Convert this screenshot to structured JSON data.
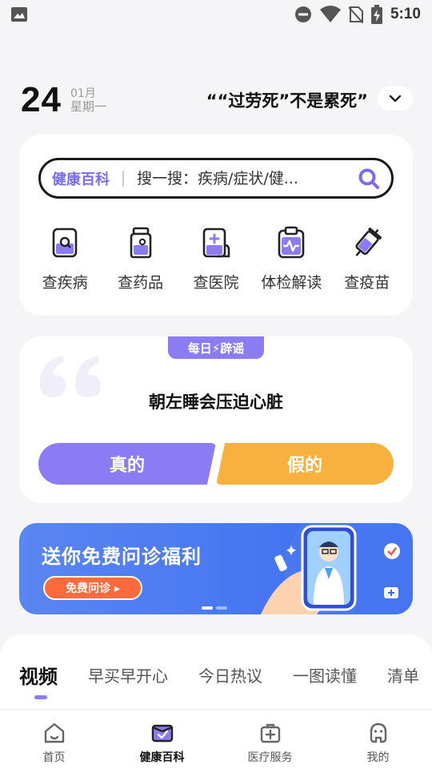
{
  "status_bar": {
    "time": "5:10",
    "icons": [
      "gallery-icon",
      "do-not-disturb-icon",
      "wifi-icon",
      "no-sim-icon",
      "battery-charging-icon"
    ]
  },
  "date": {
    "day": "24",
    "month": "01月",
    "weekday": "星期一"
  },
  "headline": "““过劳死”不是累死”",
  "search": {
    "tag": "健康百科",
    "placeholder": "搜一搜：疾病/症状/健..."
  },
  "quick_links": [
    {
      "label": "查疾病",
      "icon": "disease-icon"
    },
    {
      "label": "查药品",
      "icon": "medicine-bottle-icon"
    },
    {
      "label": "查医院",
      "icon": "hospital-icon"
    },
    {
      "label": "体检解读",
      "icon": "checkup-report-icon"
    },
    {
      "label": "查疫苗",
      "icon": "vaccine-icon"
    }
  ],
  "rumor": {
    "badge": "每日⚡辟谣",
    "statement": "朝左睡会压迫心脏",
    "true_label": "真的",
    "false_label": "假的"
  },
  "banner": {
    "title": "送你免费问诊福利",
    "button": "免费问诊 ▸"
  },
  "feed_tabs": [
    "视频",
    "早买早开心",
    "今日热议",
    "一图读懂",
    "清单"
  ],
  "bottom_nav": [
    {
      "label": "首页",
      "icon": "home-icon"
    },
    {
      "label": "健康百科",
      "icon": "health-book-icon"
    },
    {
      "label": "医疗服务",
      "icon": "medical-kit-icon"
    },
    {
      "label": "我的",
      "icon": "profile-icon"
    }
  ],
  "colors": {
    "accent": "#8b7cf5",
    "orange": "#f8b13f",
    "banner_blue": "#3a6cf0"
  }
}
